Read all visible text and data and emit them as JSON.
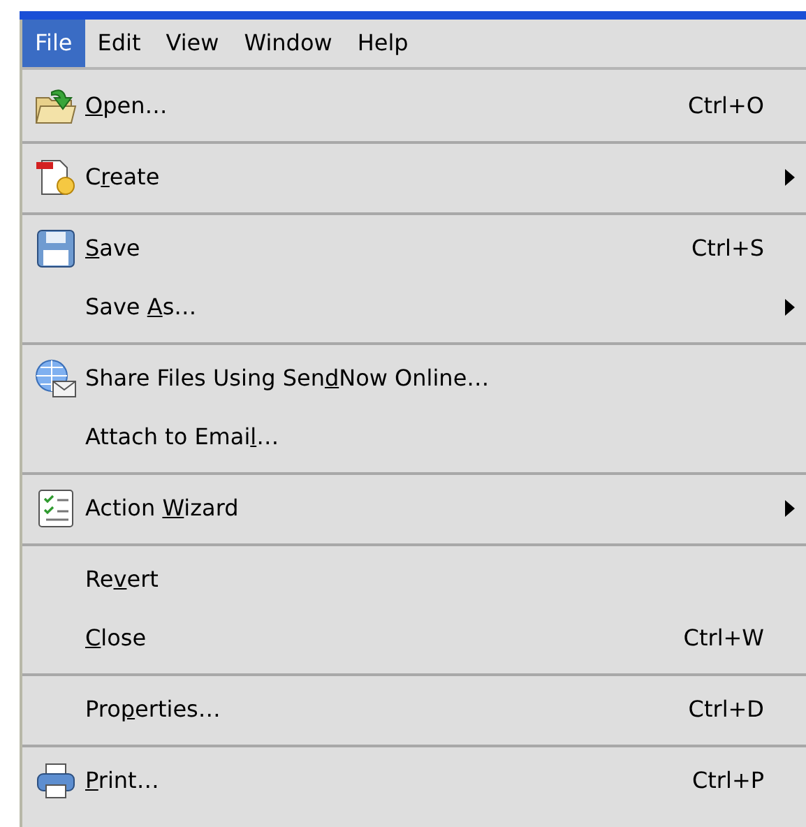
{
  "menubar": [
    {
      "label": "File",
      "selected": true
    },
    {
      "label": "Edit",
      "selected": false
    },
    {
      "label": "View",
      "selected": false
    },
    {
      "label": "Window",
      "selected": false
    },
    {
      "label": "Help",
      "selected": false
    }
  ],
  "menu": [
    {
      "kind": "folder",
      "label": {
        "key": "O",
        "after": "pen…"
      },
      "shortcut": "Ctrl+O",
      "submenu": false
    },
    {
      "kind": "separator"
    },
    {
      "kind": "document",
      "label": {
        "before": "C",
        "key": "r",
        "after": "eate"
      },
      "submenu": true
    },
    {
      "kind": "separator"
    },
    {
      "kind": "floppy",
      "label": {
        "key": "S",
        "after": "ave"
      },
      "shortcut": "Ctrl+S",
      "submenu": false
    },
    {
      "kind": "plain",
      "label": {
        "before": "Save ",
        "key": "A",
        "after": "s…"
      },
      "submenu": true
    },
    {
      "kind": "separator"
    },
    {
      "kind": "globe",
      "label": {
        "before": "Share Files Using Sen",
        "key": "d",
        "after": "Now Online…"
      },
      "submenu": false
    },
    {
      "kind": "plain",
      "label": {
        "before": "Attach to Emai",
        "key": "l",
        "after": "…"
      },
      "submenu": false
    },
    {
      "kind": "separator"
    },
    {
      "kind": "checklist",
      "label": {
        "before": "Action ",
        "key": "W",
        "after": "izard"
      },
      "submenu": true
    },
    {
      "kind": "separator"
    },
    {
      "kind": "plain",
      "label": {
        "before": "Re",
        "key": "v",
        "after": "ert"
      },
      "submenu": false
    },
    {
      "kind": "plain",
      "label": {
        "key": "C",
        "after": "lose"
      },
      "shortcut": "Ctrl+W",
      "submenu": false
    },
    {
      "kind": "separator"
    },
    {
      "kind": "plain",
      "label": {
        "before": "Pro",
        "key": "p",
        "after": "erties…"
      },
      "shortcut": "Ctrl+D",
      "submenu": false
    },
    {
      "kind": "separator"
    },
    {
      "kind": "printer",
      "label": {
        "key": "P",
        "after": "rint…"
      },
      "shortcut": "Ctrl+P",
      "submenu": false
    }
  ]
}
